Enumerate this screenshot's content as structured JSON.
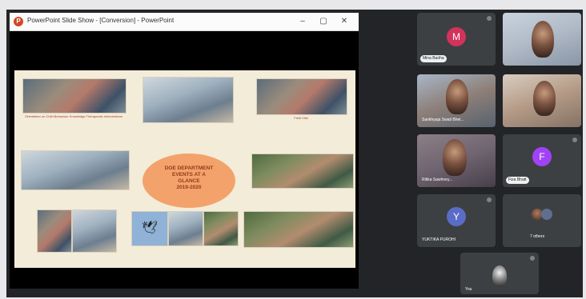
{
  "window": {
    "logo_letter": "P",
    "title": "PowerPoint Slide Show - [Conversion] - PowerPoint",
    "controls": [
      "–",
      "▢",
      "✕"
    ]
  },
  "slide": {
    "center_title_lines": [
      "DOE DEPARTMENT",
      "EVENTS AT A",
      "GLANCE",
      "2019-2020"
    ],
    "photo_captions": [
      "Orientation on Child Behaviour Knowledge Therapeutic Interventions",
      "",
      "Field Visit",
      "",
      "",
      "",
      "",
      "",
      ""
    ]
  },
  "participants": [
    {
      "initial": "M",
      "avatar_color": "#d3335b",
      "name": "Mina Bariha",
      "style": "avatar"
    },
    {
      "name": "",
      "style": "video"
    },
    {
      "name": "Sankhyaja Swati Bhel...",
      "style": "video"
    },
    {
      "name": "",
      "style": "video"
    },
    {
      "name": "Ritika Sawhney...",
      "style": "video"
    },
    {
      "initial": "F",
      "avatar_color": "#a142f4",
      "name": "Fiza Bhatt",
      "style": "avatar"
    },
    {
      "initial": "Y",
      "avatar_color": "#5a6cc6",
      "name": "YUKTIKA PUROHI",
      "style": "avatar"
    },
    {
      "name": "7 others",
      "style": "group"
    },
    {
      "name": "You",
      "style": "self"
    }
  ],
  "colors": {
    "meet_bg": "#232427",
    "tile_bg": "#3c4043",
    "slide_bg": "#f3ecd9",
    "oval": "#f4a26b",
    "caption": "#b0392b"
  }
}
